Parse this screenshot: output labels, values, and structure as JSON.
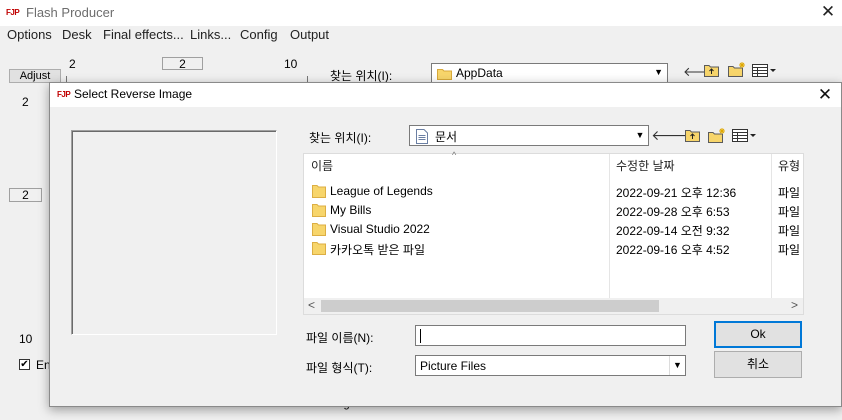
{
  "app": {
    "logo": "FJP",
    "title": "Flash Producer",
    "menu": [
      "Options",
      "Desk",
      "Final effects...",
      "Links...",
      "Config",
      "Output"
    ],
    "bg": {
      "num_left": "2",
      "spin_mid": "2",
      "num_right": "10",
      "adjust_label": "Adjust",
      "side_num_top": "2",
      "side_spin": "2",
      "side_num_bottom": "10",
      "look_in_label": "찾는 위치(I):",
      "look_in_value": "AppData",
      "checkbox_mark": "✔",
      "checkbox_label": "En",
      "height_label": "Height"
    }
  },
  "dialog": {
    "logo": "FJP",
    "title": "Select Reverse Image",
    "look_in_label": "찾는 위치(I):",
    "look_in_value": "문서",
    "columns": {
      "name": "이름",
      "date": "수정한 날짜",
      "type": "유형"
    },
    "files": [
      {
        "name": "League of Legends",
        "date": "2022-09-21 오후 12:36",
        "type": "파일"
      },
      {
        "name": "My Bills",
        "date": "2022-09-28 오후 6:53",
        "type": "파일"
      },
      {
        "name": "Visual Studio 2022",
        "date": "2022-09-14 오전 9:32",
        "type": "파일"
      },
      {
        "name": "카카오톡 받은 파일",
        "date": "2022-09-16 오후 4:52",
        "type": "파일"
      }
    ],
    "filename_label": "파일 이름(N):",
    "filename_value": "",
    "filetype_label": "파일 형식(T):",
    "filetype_value": "Picture Files",
    "ok_label": "Ok",
    "cancel_label": "취소"
  },
  "colors": {
    "accent": "#0078d7",
    "folder": "#f7d56b",
    "logo": "#c00000"
  }
}
